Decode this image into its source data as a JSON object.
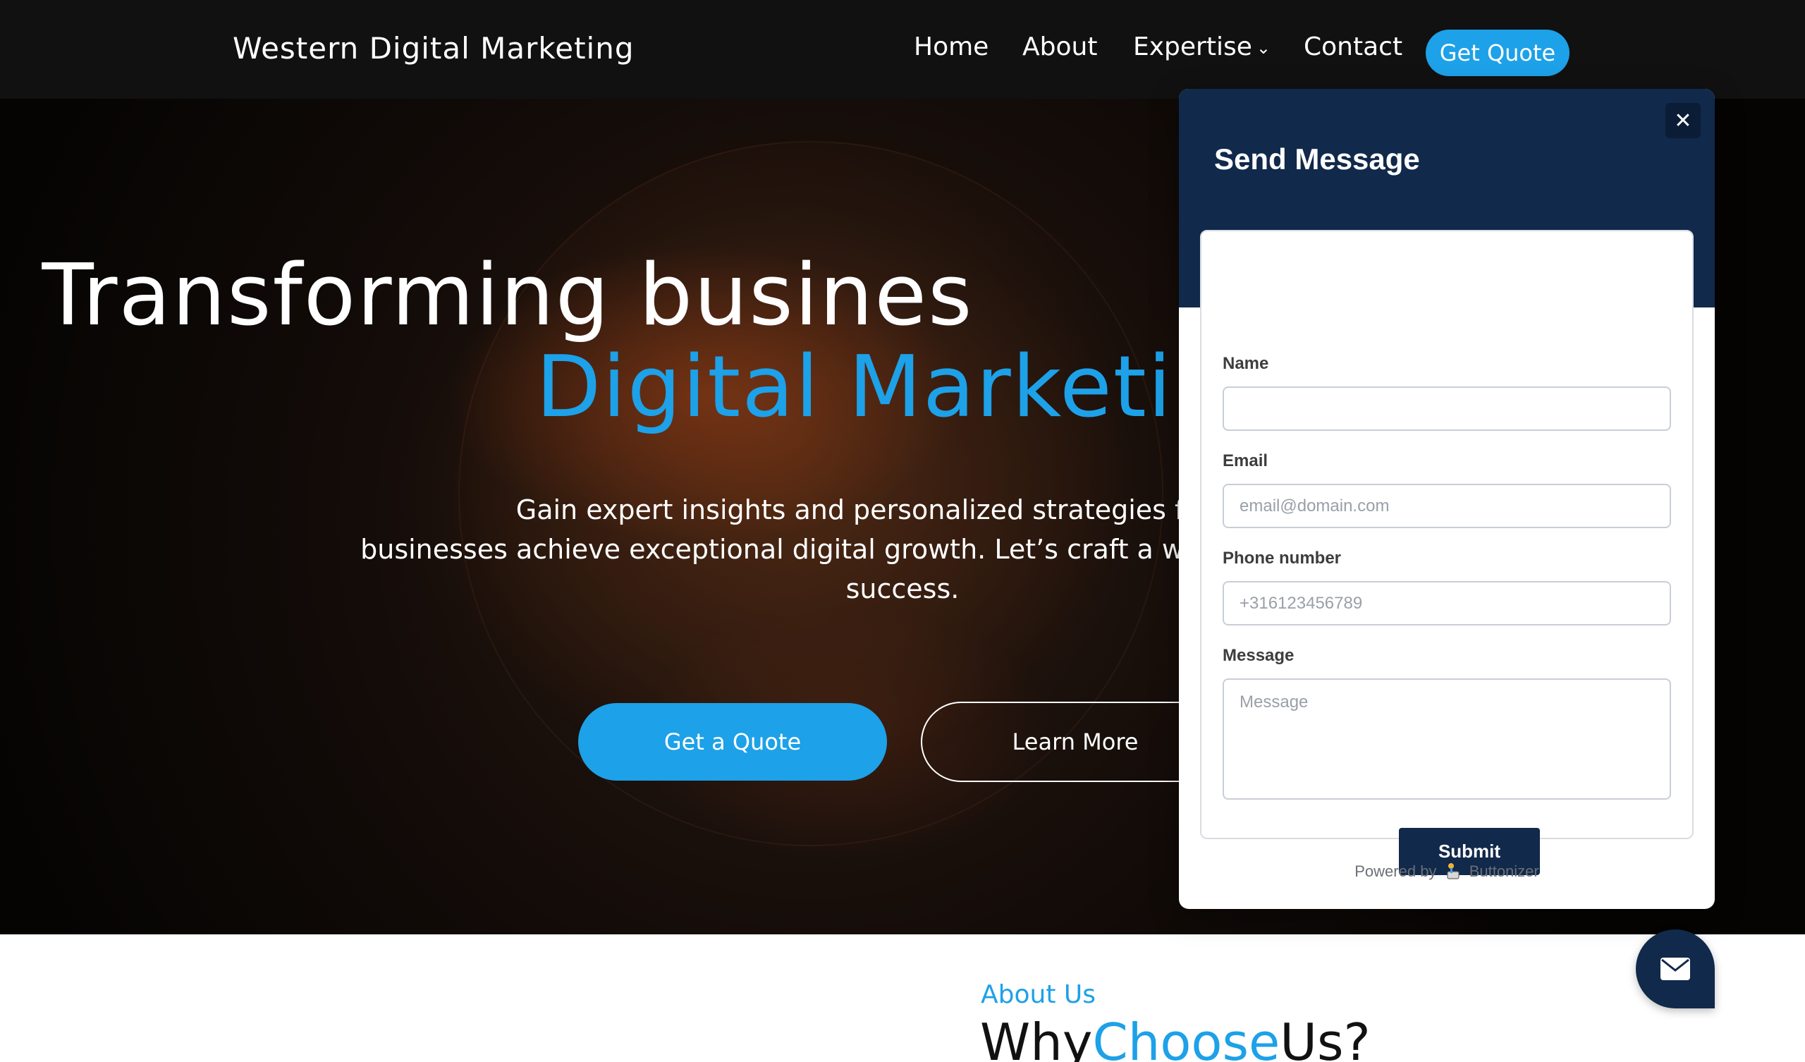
{
  "nav": {
    "brand": "Western Digital Marketing",
    "links": [
      "Home",
      "About",
      "Expertise",
      "Contact"
    ],
    "quote_button": "Get Quote"
  },
  "hero": {
    "title_line1": "Transforming busines",
    "title_line2": "Digital Marketi",
    "subtitle_line1": "Gain expert insights and personalized strategies from industry le",
    "subtitle_line2": "businesses achieve exceptional digital growth. Let’s craft a winning ma",
    "subtitle_line3": "success.",
    "primary_button": "Get a Quote",
    "secondary_button": "Learn More"
  },
  "about": {
    "label": "About Us",
    "heading_part1": "Why",
    "heading_part2": "Choose",
    "heading_part3": "Us?"
  },
  "modal": {
    "title": "Send Message",
    "close_glyph": "✕",
    "fields": {
      "name_label": "Name",
      "name_value": "",
      "email_label": "Email",
      "email_placeholder": "email@domain.com",
      "phone_label": "Phone number",
      "phone_placeholder": "+316123456789",
      "message_label": "Message",
      "message_placeholder": "Message"
    },
    "submit_label": "Submit",
    "powered_prefix": "Powered by",
    "powered_brand": "Buttonizer"
  },
  "fab": {
    "icon": "envelope-icon"
  },
  "colors": {
    "accent": "#1da1e8",
    "navy": "#11294a",
    "navbar": "#111111"
  }
}
